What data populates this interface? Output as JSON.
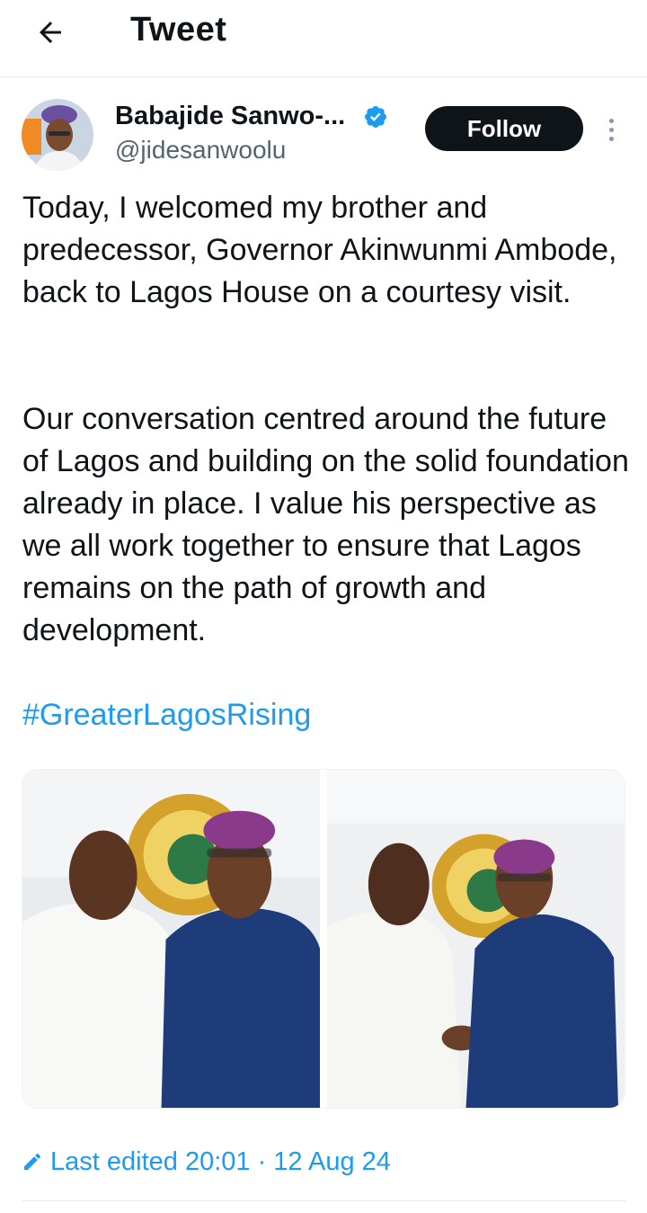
{
  "header": {
    "title": "Tweet",
    "back_icon": "arrow-left-icon"
  },
  "author": {
    "name": "Babajide Sanwo-...",
    "handle": "@jidesanwoolu",
    "verified_icon": "verified-badge-icon",
    "follow_label": "Follow"
  },
  "tweet": {
    "paragraphs": [
      "Today, I welcomed my brother and predecessor, Governor Akinwunmi Ambode, back to Lagos House on a courtesy visit.",
      "Our conversation centred around the future of Lagos and building on the solid foundation already in place. I value his perspective as we all work together to ensure that Lagos remains on the path of growth and development."
    ],
    "hashtag": "#GreaterLagosRising",
    "edited_label": "Last edited 20:01 · 12 Aug 24"
  },
  "colors": {
    "accent": "#1d9bf0",
    "text": "#0f1419",
    "secondary_text": "#536471",
    "follow_bg": "#0f1419"
  }
}
